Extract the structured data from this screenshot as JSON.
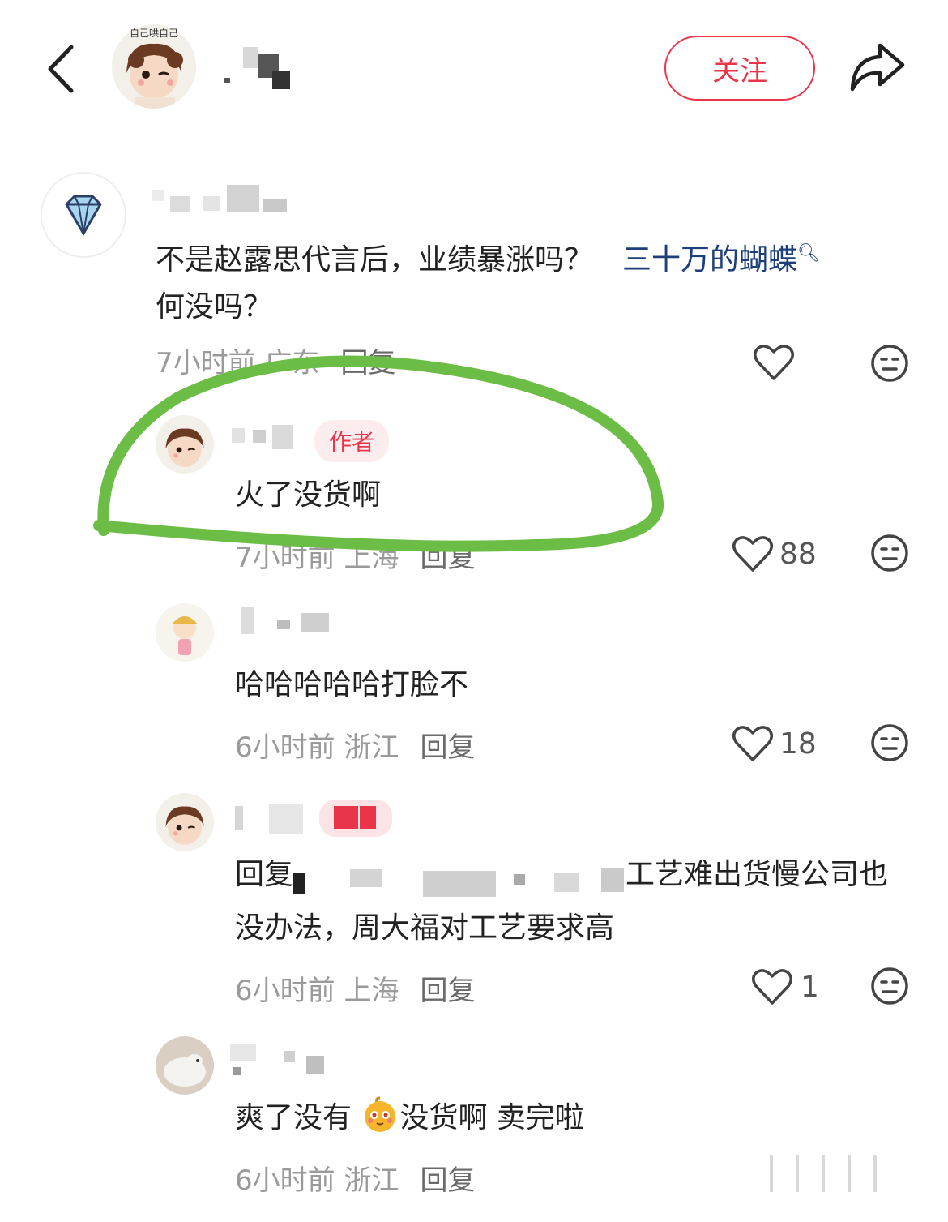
{
  "header": {
    "follow_label": "关注",
    "avatar_caption": "自己哄自己"
  },
  "comments": [
    {
      "text_line1": "不是赵露思代言后，业绩暴涨吗？",
      "link_text": "三十万的蝴蝶",
      "text_line2": "何没吗？",
      "time": "7小时前",
      "location": "广东",
      "reply": "回复"
    },
    {
      "badge": "作者",
      "text": "火了没货啊",
      "time": "7小时前",
      "location": "上海",
      "reply": "回复",
      "likes": "88"
    },
    {
      "text": "哈哈哈哈哈打脸不",
      "time": "6小时前",
      "location": "浙江",
      "reply": "回复",
      "likes": "18"
    },
    {
      "text_prefix": "回复",
      "text_line1_end": "工艺难出货慢公司也",
      "text_line2": "没办法，周大福对工艺要求高",
      "time": "6小时前",
      "location": "上海",
      "reply": "回复",
      "likes": "1"
    },
    {
      "text_part1": "爽了没有",
      "text_part2": "没货啊 卖完啦",
      "time": "6小时前",
      "location": "浙江",
      "reply": "回复"
    }
  ],
  "colors": {
    "accent": "#e8354a",
    "link": "#1d3f7a",
    "highlight": "#6bbd45"
  }
}
